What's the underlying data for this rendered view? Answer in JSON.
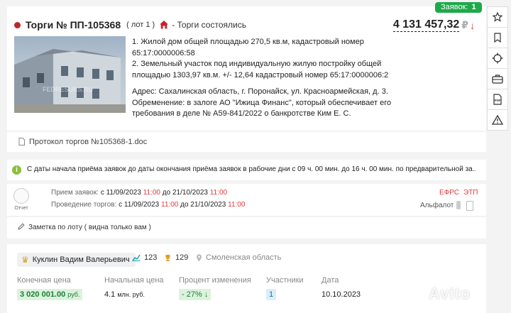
{
  "lot": {
    "applications_badge_label": "Заявок:",
    "applications_badge_count": "1",
    "title": "Торги № ПП-105368",
    "lot_number": "( лот 1 )",
    "status": "- Торги состоялись",
    "price": "4 131 457,32",
    "currency": "₽",
    "photo_watermark": "FEDRESURS.RU",
    "description_lines": [
      "1. Жилой дом общей площадью 270,5 кв.м, кадастровый номер",
      "65:17:0000006:58",
      "2. Земельный участок под индивидуальную жилую постройку общей",
      "площадью 1303,97 кв.м. +/- 12,64 кадастровый номер 65:17:0000006:2",
      "Адрес: Сахалинская область, г. Поронайск, ул. Красноармейская, д. 3.",
      "Обременение: в залоге АО \"Ижица Финанс\", который обеспечивает его",
      "требования в деле № А59-841/2022 о банкротстве Ким Е. С."
    ]
  },
  "document": {
    "label": "Протокол торгов №105368-1.doc"
  },
  "info": {
    "text": "С даты начала приёма заявок до даты окончания приёма заявок в рабочие дни с 09 ч. 00 мин. до 16 ч. 00 мин. по предварительной за..."
  },
  "schedule": {
    "report_label": "Отчет",
    "acceptance_label": "Прием заявок:",
    "acceptance_from": "с 11/09/2023",
    "acceptance_from_time": "11:00",
    "acceptance_to": "до 21/10/2023",
    "acceptance_to_time": "11:00",
    "auction_label": "Проведение торгов:",
    "auction_from": "с 11/09/2023",
    "auction_from_time": "11:00",
    "auction_to": "до 21/10/2023",
    "auction_to_time": "11:00",
    "efrs": "ЕФРС",
    "etp": "ЭТП",
    "platform": "Альфалот"
  },
  "note": {
    "label": "Заметка по лоту ( видна только вам )"
  },
  "winner": {
    "name": "Куклин Вадим Валерьевич",
    "stat_chart": "123",
    "stat_trophy": "129",
    "region": "Смоленская область",
    "final_price_label": "Конечная цена",
    "final_price_value": "3 020 001.00",
    "final_price_unit": "руб.",
    "start_price_label": "Начальная цена",
    "start_price_value": "4.1",
    "start_price_unit": "млн. руб.",
    "change_label": "Процент изменения",
    "change_value": "- 27%",
    "participants_label": "Участники",
    "participants_value": "1",
    "date_label": "Дата",
    "date_value": "10.10.2023"
  },
  "watermark": "Avito",
  "sidebar_icons": [
    "star-icon",
    "bookmark-icon",
    "crosshair-icon",
    "briefcase-icon",
    "pdf-icon",
    "warning-icon"
  ],
  "colors": {
    "accent_green": "#1fa84a",
    "status_red": "#c0252b",
    "time_red": "#e03a3a"
  }
}
